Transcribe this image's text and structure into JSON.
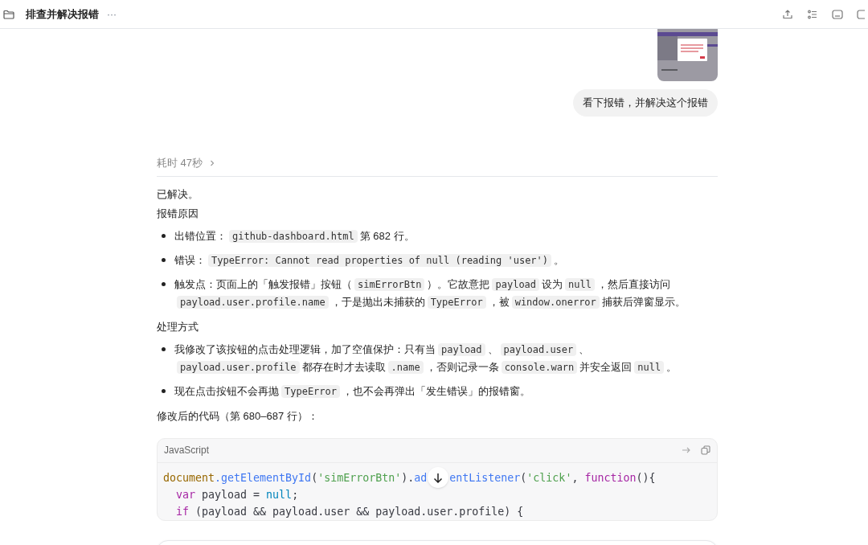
{
  "header": {
    "title": "排查并解决报错",
    "more": "···"
  },
  "user_message": {
    "text": "看下报错，并解决这个报错"
  },
  "reply": {
    "duration": "耗时 47秒",
    "expanded": false,
    "blocks": [
      {
        "kind": "para",
        "segments": [
          {
            "text": "已解决。"
          }
        ]
      },
      {
        "kind": "heading",
        "segments": [
          {
            "text": "报错原因"
          }
        ]
      },
      {
        "kind": "list",
        "items": [
          [
            {
              "text": "出错位置："
            },
            {
              "code": "github-dashboard.html"
            },
            {
              "text": "第 682 行。"
            }
          ],
          [
            {
              "text": "错误："
            },
            {
              "code": "TypeError: Cannot read properties of null (reading 'user')"
            },
            {
              "text": "。"
            }
          ],
          [
            {
              "text": "触发点：页面上的「触发报错」按钮（"
            },
            {
              "code": "simErrorBtn"
            },
            {
              "text": "）。它故意把"
            },
            {
              "code": "payload"
            },
            {
              "text": "设为"
            },
            {
              "code": "null"
            },
            {
              "text": "，然后直接访问"
            },
            {
              "code": "payload.user.profile.name"
            },
            {
              "text": "，于是抛出未捕获的"
            },
            {
              "code": "TypeError"
            },
            {
              "text": "，被"
            },
            {
              "code": "window.onerror"
            },
            {
              "text": "捕获后弹窗显示。"
            }
          ]
        ]
      },
      {
        "kind": "heading",
        "segments": [
          {
            "text": "处理方式"
          }
        ]
      },
      {
        "kind": "list",
        "items": [
          [
            {
              "text": "我修改了该按钮的点击处理逻辑，加了空值保护：只有当"
            },
            {
              "code": "payload"
            },
            {
              "text": "、"
            },
            {
              "code": "payload.user"
            },
            {
              "text": "、"
            },
            {
              "code": "payload.user.profile"
            },
            {
              "text": "都存在时才去读取"
            },
            {
              "code": ".name"
            },
            {
              "text": "，否则记录一条"
            },
            {
              "code": "console.warn"
            },
            {
              "text": "并安全返回"
            },
            {
              "code": "null"
            },
            {
              "text": "。"
            }
          ],
          [
            {
              "text": "现在点击按钮不会再抛"
            },
            {
              "code": "TypeError"
            },
            {
              "text": "，也不会再弹出「发生错误」的报错窗。"
            }
          ]
        ]
      },
      {
        "kind": "para",
        "segments": [
          {
            "text": "修改后的代码（第 680–687 行）："
          }
        ]
      }
    ],
    "code_block": {
      "language": "JavaScript",
      "lines": [
        {
          "parts": [
            [
              {
                "text": "document",
                "kind": "object"
              },
              {
                "text": ".getElementById",
                "kind": "method"
              },
              {
                "text": "(",
                "kind": "plain"
              },
              {
                "text": "'simErrorBtn'",
                "kind": "string"
              },
              {
                "text": ").",
                "kind": "plain"
              },
              {
                "text": "ad",
                "kind": "method"
              }
            ],
            [
              {
                "text": "entListener",
                "kind": "method"
              },
              {
                "text": "(",
                "kind": "plain"
              },
              {
                "text": "'click'",
                "kind": "string"
              },
              {
                "text": ", ",
                "kind": "plain"
              },
              {
                "text": "function",
                "kind": "keyword"
              },
              {
                "text": "(){",
                "kind": "plain"
              }
            ]
          ]
        },
        {
          "parts": [
            [
              {
                "text": "  var",
                "kind": "keyword"
              },
              {
                "text": " payload = ",
                "kind": "plain"
              },
              {
                "text": "null",
                "kind": "literal"
              },
              {
                "text": ";",
                "kind": "plain"
              }
            ]
          ]
        },
        {
          "parts": [
            [
              {
                "text": "  if",
                "kind": "keyword"
              },
              {
                "text": " (payload && payload.user && payload.user.profile) {",
                "kind": "plain"
              }
            ]
          ]
        }
      ]
    }
  }
}
